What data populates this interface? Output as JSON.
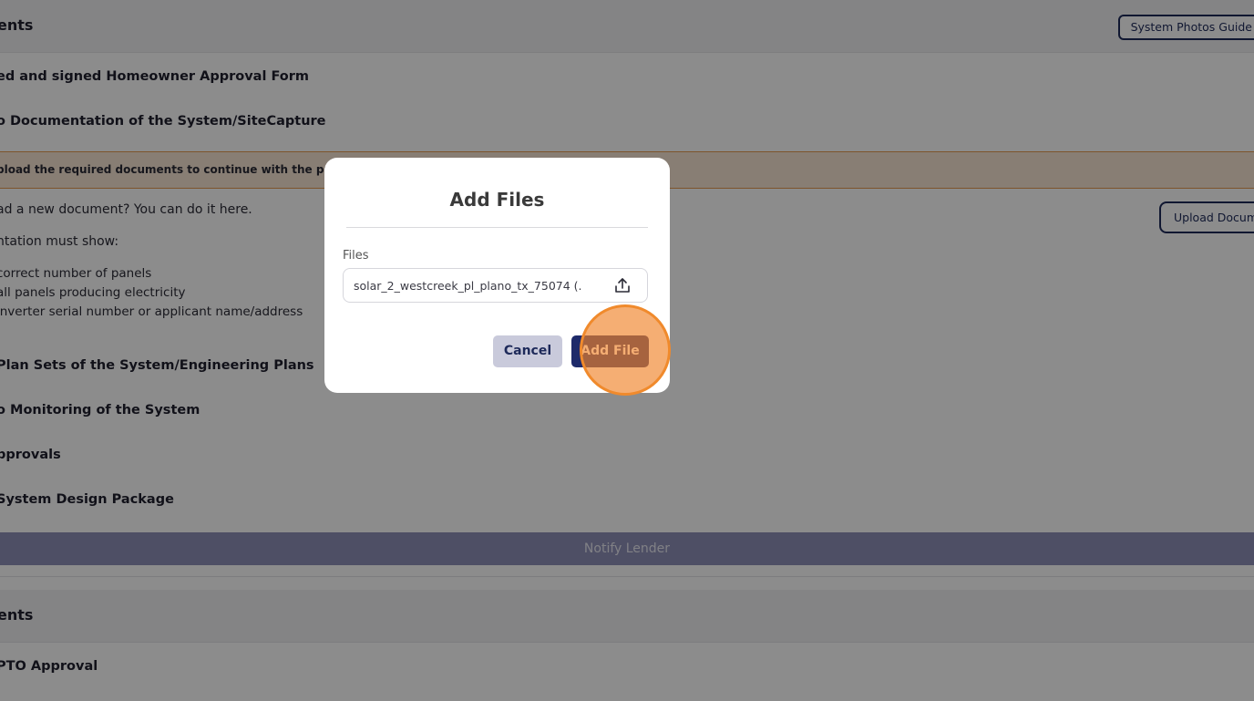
{
  "section1": {
    "title": "ents",
    "guide_button": "System Photos Guide"
  },
  "rows_top": [
    "ed and signed Homeowner Approval Form",
    "o Documentation of the System/SiteCapture"
  ],
  "warning": "pload the required documents to continue with the proce",
  "info": {
    "upload_prompt": "ad a new document? You can do it here.",
    "must_show": "ntation must show:",
    "bullets": [
      " correct number of panels",
      " all panels producing electricity",
      " inverter serial number or applicant name/address"
    ],
    "upload_button": "Upload Docum"
  },
  "rows_bottom": [
    "Plan Sets of the System/Engineering Plans",
    "o Monitoring of the System",
    "pprovals",
    " System Design Package"
  ],
  "notify_button": "Notify Lender",
  "section2": {
    "title": "ents",
    "row": "PTO Approval"
  },
  "modal": {
    "title": "Add Files",
    "files_label": "Files",
    "file_value": "solar_2_westcreek_pl_plano_tx_75074 (...",
    "cancel": "Cancel",
    "add": "Add File"
  },
  "colors": {
    "accent": "#1e2a6a",
    "warning_bg": "#f7e6d4",
    "click_marker": "#f08a2c"
  }
}
